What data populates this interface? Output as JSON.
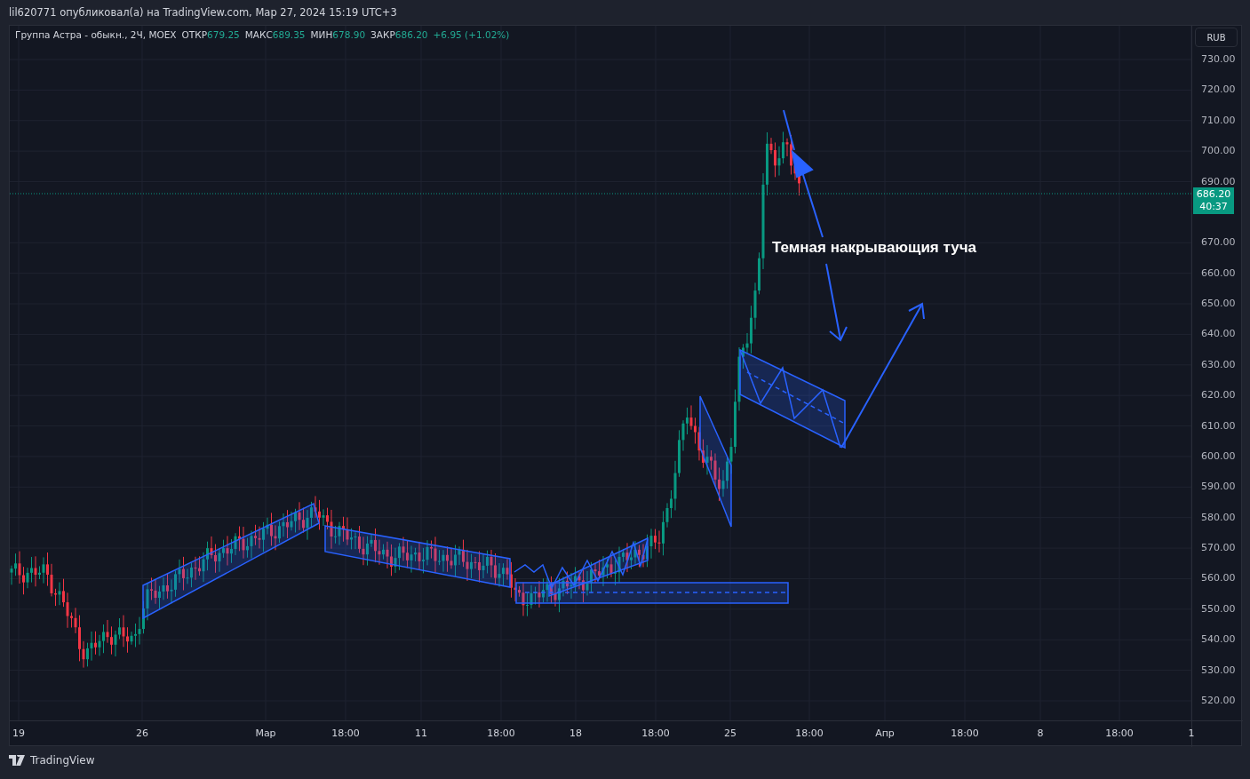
{
  "header": {
    "text": "lil620771 опубликовал(а) на TradingView.com, Мар 27, 2024 15:19 UTC+3"
  },
  "legend": {
    "symbol": "Группа Астра - обыкн., 2Ч, MOEX",
    "ohlc": [
      {
        "label": "ОТКР",
        "value": "679.25"
      },
      {
        "label": "МАКС",
        "value": "689.35"
      },
      {
        "label": "МИН",
        "value": "678.90"
      },
      {
        "label": "ЗАКР",
        "value": "686.20"
      }
    ],
    "change": "+6.95 (+1.02%)"
  },
  "currency_button": "RUB",
  "price_axis": [
    "730.00",
    "720.00",
    "710.00",
    "700.00",
    "690.00",
    "670.00",
    "660.00",
    "650.00",
    "640.00",
    "630.00",
    "620.00",
    "610.00",
    "600.00",
    "590.00",
    "580.00",
    "570.00",
    "560.00",
    "550.00",
    "540.00",
    "530.00",
    "520.00"
  ],
  "last_price": {
    "price": "686.20",
    "countdown": "40:37"
  },
  "time_axis": [
    "19",
    "26",
    "Мар",
    "18:00",
    "11",
    "18:00",
    "18",
    "18:00",
    "25",
    "18:00",
    "Апр",
    "18:00",
    "8",
    "18:00",
    "1"
  ],
  "annotation": "Темная накрывающия туча",
  "footer": {
    "brand": "TradingView"
  }
}
